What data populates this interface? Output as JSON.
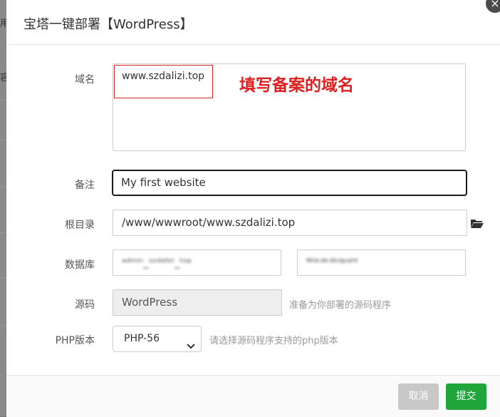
{
  "background": {
    "left_chars": [
      "用",
      "容"
    ]
  },
  "dialog": {
    "title": "宝塔一键部署【WordPress】",
    "close_glyph": "×"
  },
  "form": {
    "domain": {
      "label": "域名",
      "value": "www.szdalizi.top",
      "annotation": "填写备案的域名"
    },
    "remark": {
      "label": "备注",
      "value": "My first website"
    },
    "root": {
      "label": "根目录",
      "value": "/www/wwwroot/www.szdalizi.top",
      "icon": "folder-open-icon"
    },
    "database": {
      "label": "数据库",
      "user_value": "ᵃᵈᵐⁱⁿ_ˢᶻᵈᵃˡⁱᶻⁱ_ᵗᵒᵖ",
      "password_value": "ᴺʰᵏᵈᵏᵈᵇᵈᵖᵃʰᵗ"
    },
    "source": {
      "label": "源码",
      "value": "WordPress",
      "hint": "准备为你部署的源码程序"
    },
    "php": {
      "label": "PHP版本",
      "selected": "PHP-56",
      "hint": "请选择源码程序支持的php版本"
    }
  },
  "footer": {
    "cancel_label": "取消",
    "submit_label": "提交"
  },
  "colors": {
    "submit": "#20a53a",
    "cancel": "#c8c8c8",
    "annotation": "#e02020"
  }
}
